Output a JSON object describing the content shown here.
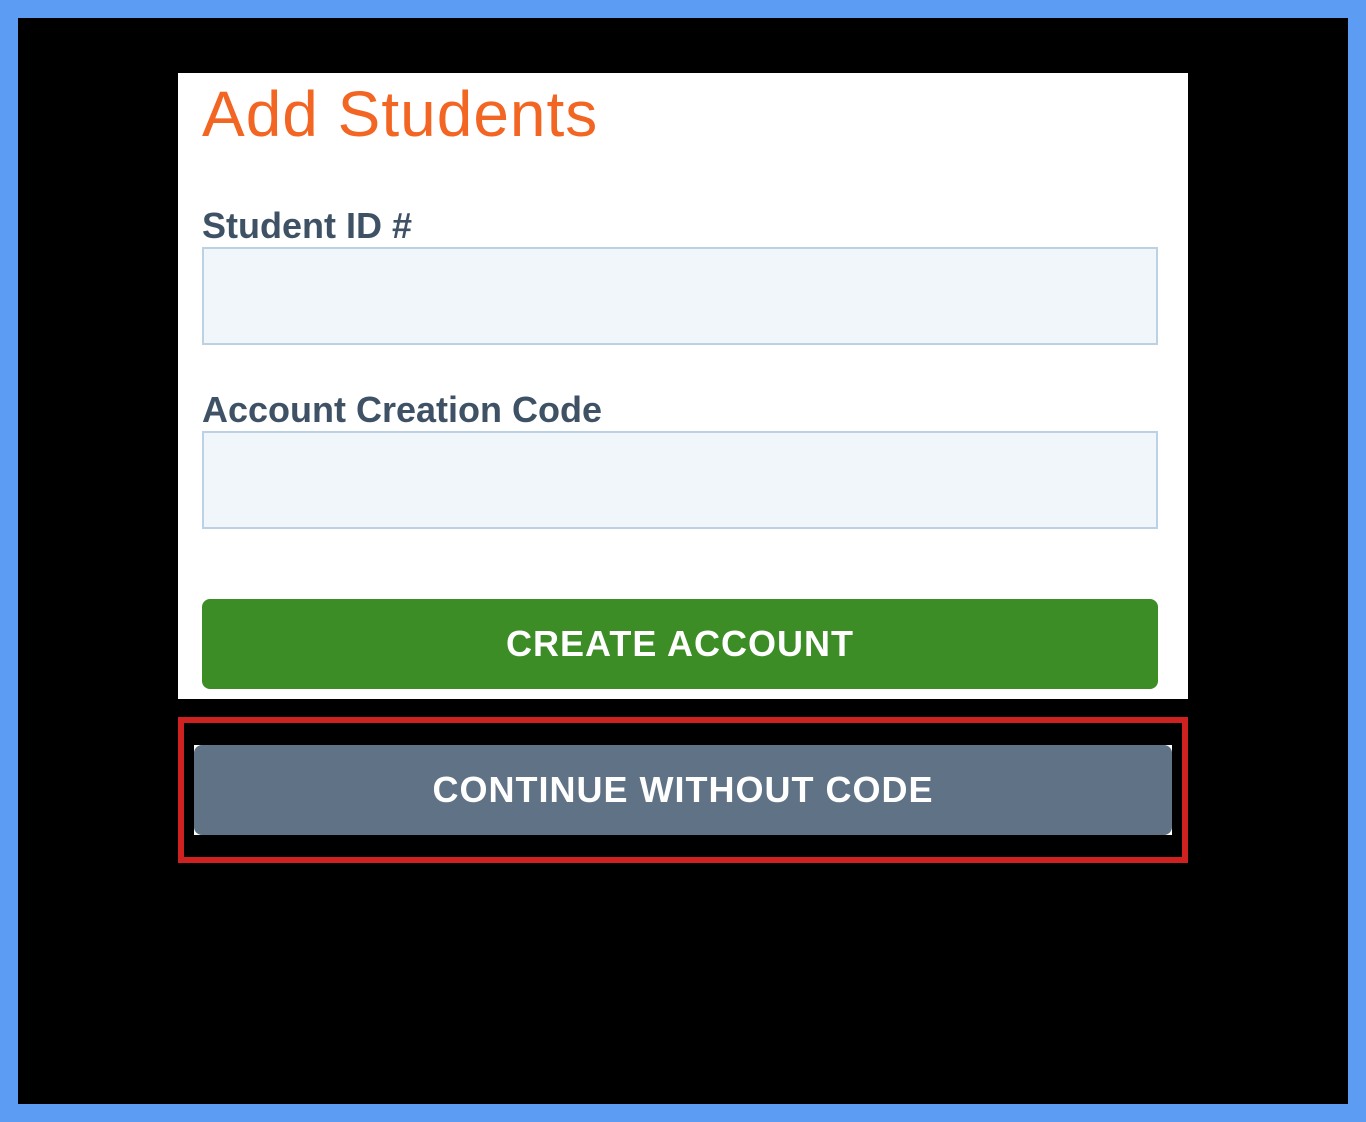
{
  "form": {
    "title": "Add Students",
    "student_id_label": "Student ID #",
    "student_id_value": "",
    "code_label": "Account Creation Code",
    "code_value": "",
    "create_button_label": "CREATE ACCOUNT",
    "continue_button_label": "CONTINUE WITHOUT CODE"
  }
}
